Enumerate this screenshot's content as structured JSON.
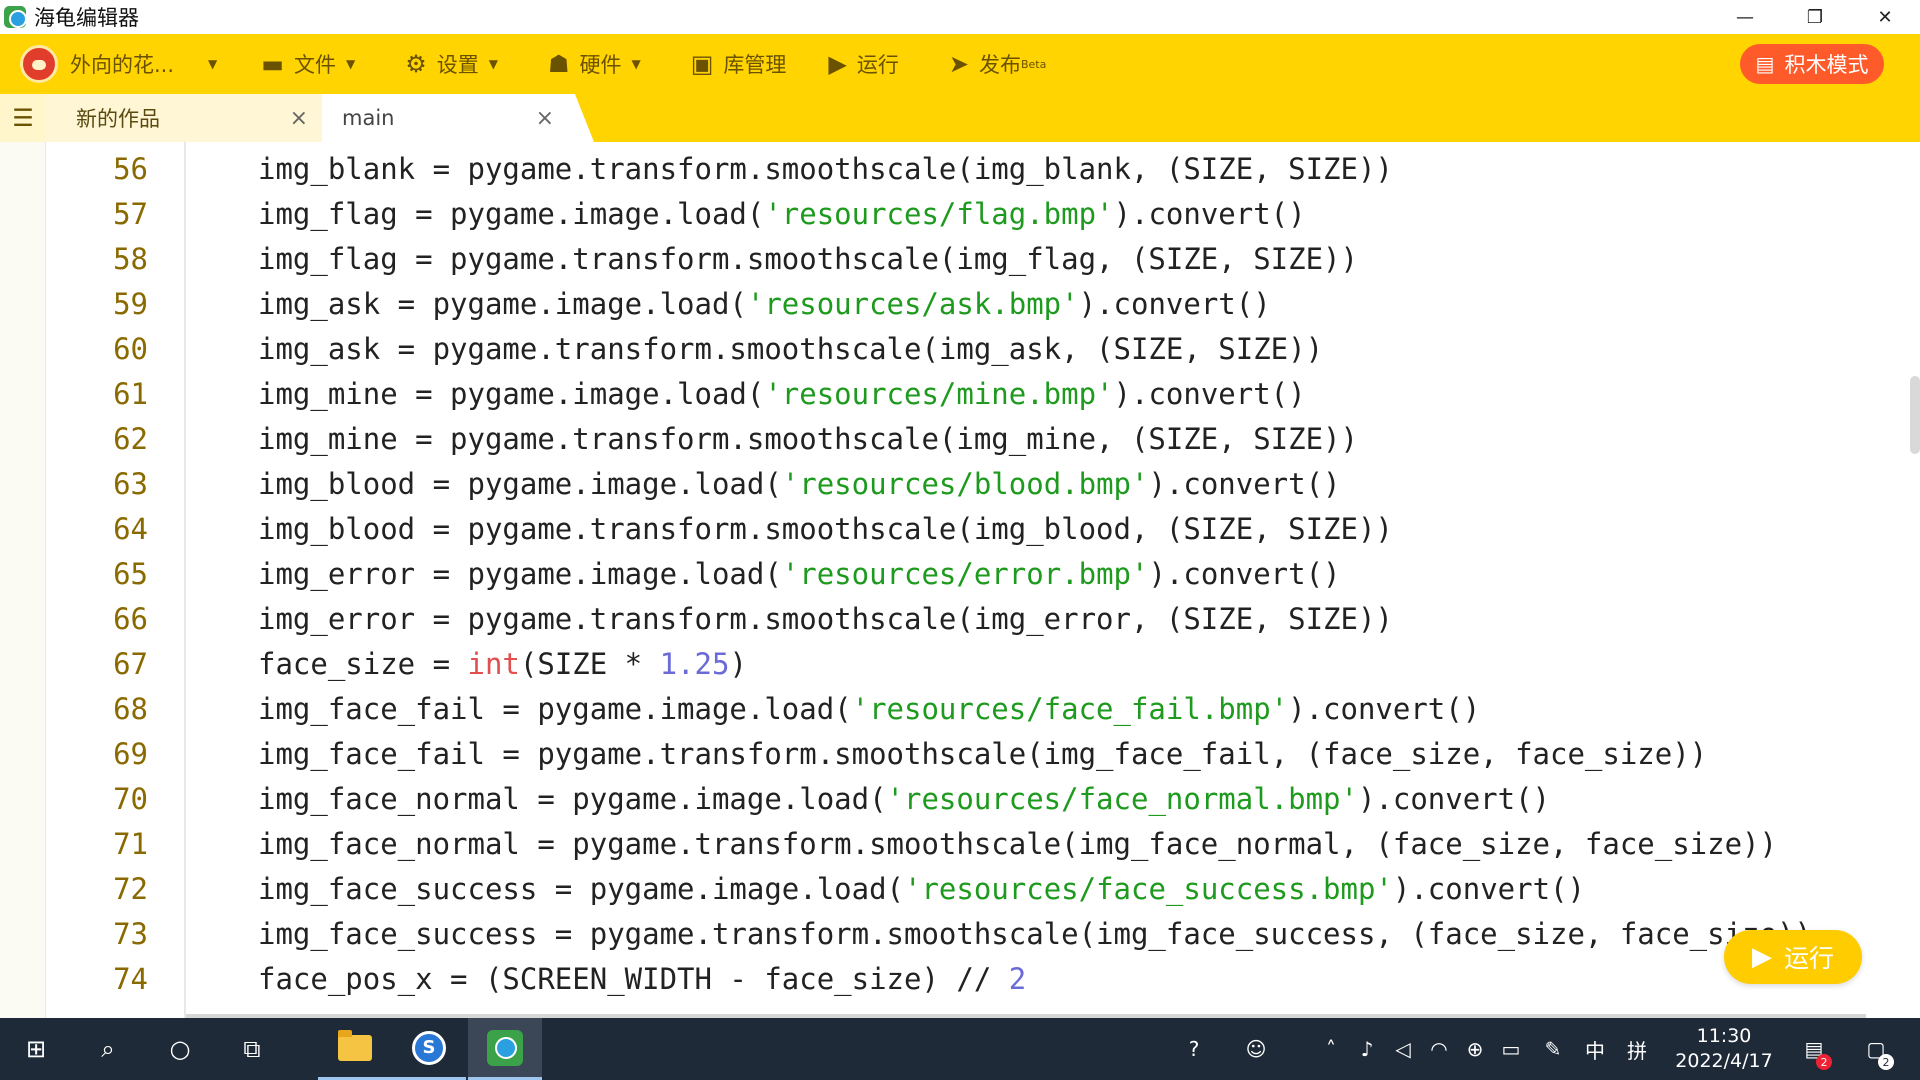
{
  "window": {
    "title": "海龟编辑器",
    "minimize": "—",
    "restore": "❐",
    "close": "✕"
  },
  "toolbar": {
    "user_name": "外向的花...",
    "file": "文件",
    "settings": "设置",
    "hardware": "硬件",
    "library": "库管理",
    "run": "运行",
    "publish": "发布",
    "publish_badge": "Beta",
    "block_mode": "积木模式"
  },
  "tabs": [
    {
      "label": "新的作品",
      "close": "×"
    },
    {
      "label": "main",
      "close": "×"
    }
  ],
  "code_lines": [
    {
      "num": "56",
      "html": "img_blank = pygame.transform.smoothscale(img_blank, (SIZE, SIZE))"
    },
    {
      "num": "57",
      "html": "img_flag = pygame.image.load(<span class='s'>'resources/flag.bmp'</span>).convert()"
    },
    {
      "num": "58",
      "html": "img_flag = pygame.transform.smoothscale(img_flag, (SIZE, SIZE))"
    },
    {
      "num": "59",
      "html": "img_ask = pygame.image.load(<span class='s'>'resources/ask.bmp'</span>).convert()"
    },
    {
      "num": "60",
      "html": "img_ask = pygame.transform.smoothscale(img_ask, (SIZE, SIZE))"
    },
    {
      "num": "61",
      "html": "img_mine = pygame.image.load(<span class='s'>'resources/mine.bmp'</span>).convert()"
    },
    {
      "num": "62",
      "html": "img_mine = pygame.transform.smoothscale(img_mine, (SIZE, SIZE))"
    },
    {
      "num": "63",
      "html": "img_blood = pygame.image.load(<span class='s'>'resources/blood.bmp'</span>).convert()"
    },
    {
      "num": "64",
      "html": "img_blood = pygame.transform.smoothscale(img_blood, (SIZE, SIZE))"
    },
    {
      "num": "65",
      "html": "img_error = pygame.image.load(<span class='s'>'resources/error.bmp'</span>).convert()"
    },
    {
      "num": "66",
      "html": "img_error = pygame.transform.smoothscale(img_error, (SIZE, SIZE))"
    },
    {
      "num": "67",
      "html": "face_size = <span class='k'>int</span>(SIZE * <span class='n'>1.25</span>)"
    },
    {
      "num": "68",
      "html": "img_face_fail = pygame.image.load(<span class='s'>'resources/face_fail.bmp'</span>).convert()"
    },
    {
      "num": "69",
      "html": "img_face_fail = pygame.transform.smoothscale(img_face_fail, (face_size, face_size))"
    },
    {
      "num": "70",
      "html": "img_face_normal = pygame.image.load(<span class='s'>'resources/face_normal.bmp'</span>).convert()"
    },
    {
      "num": "71",
      "html": "img_face_normal = pygame.transform.smoothscale(img_face_normal, (face_size, face_size))"
    },
    {
      "num": "72",
      "html": "img_face_success = pygame.image.load(<span class='s'>'resources/face_success.bmp'</span>).convert()"
    },
    {
      "num": "73",
      "html": "img_face_success = pygame.transform.smoothscale(img_face_success, (face_size, face_size))"
    },
    {
      "num": "74",
      "html": "face_pos_x = (SCREEN_WIDTH - face_size) // <span class='n'>2</span>"
    }
  ],
  "run_button": "运行",
  "taskbar": {
    "ime_lang": "中",
    "ime_mode": "拼",
    "time": "11:30",
    "date": "2022/4/17",
    "action_center_badge": "2",
    "notifications_badge": "2"
  }
}
